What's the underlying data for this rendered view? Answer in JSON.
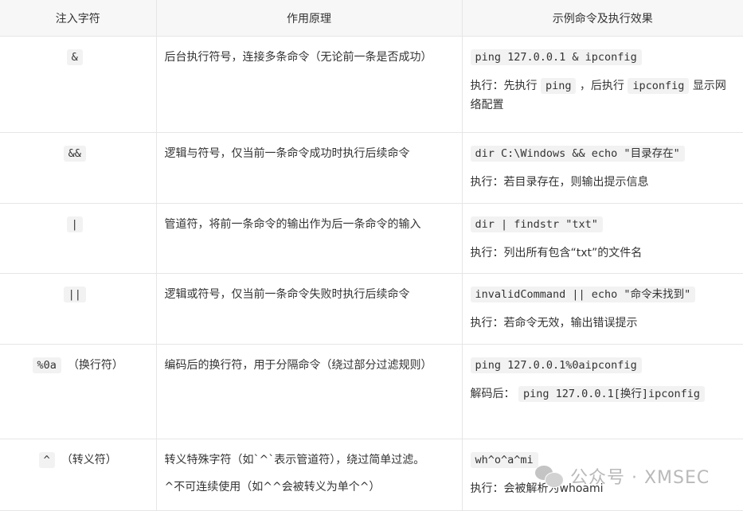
{
  "headers": [
    "注入字符",
    "作用原理",
    "示例命令及执行效果"
  ],
  "rows": [
    {
      "symbol": "&",
      "symbol_note": "",
      "principle": "后台执行符号，连接多条命令（无论前一条是否成功）",
      "principle2": "",
      "example_code": "ping 127.0.0.1 & ipconfig",
      "result_parts": [
        {
          "t": "执行：先执行 ",
          "code": false
        },
        {
          "t": "ping",
          "code": true
        },
        {
          "t": " ，后执行 ",
          "code": false
        },
        {
          "t": "ipconfig",
          "code": true
        },
        {
          "t": " 显示网络配置",
          "code": false
        }
      ]
    },
    {
      "symbol": "&&",
      "symbol_note": "",
      "principle": "逻辑与符号，仅当前一条命令成功时执行后续命令",
      "principle2": "",
      "example_code": "dir C:\\Windows && echo \"目录存在\"",
      "result_parts": [
        {
          "t": "执行：若目录存在，则输出提示信息",
          "code": false
        }
      ]
    },
    {
      "symbol": "|",
      "symbol_note": "",
      "principle": "管道符，将前一条命令的输出作为后一条命令的输入",
      "principle2": "",
      "example_code": "dir | findstr \"txt\"",
      "result_parts": [
        {
          "t": "执行：列出所有包含“txt”的文件名",
          "code": false
        }
      ]
    },
    {
      "symbol": "||",
      "symbol_note": "",
      "principle": "逻辑或符号，仅当前一条命令失败时执行后续命令",
      "principle2": "",
      "example_code": "invalidCommand || echo \"命令未找到\"",
      "result_parts": [
        {
          "t": "执行：若命令无效，输出错误提示",
          "code": false
        }
      ]
    },
    {
      "symbol": "%0a",
      "symbol_note": "（换行符）",
      "principle": "编码后的换行符，用于分隔命令（绕过部分过滤规则）",
      "principle2": "",
      "example_code": "ping 127.0.0.1%0aipconfig",
      "result_parts": [
        {
          "t": "解码后： ",
          "code": false
        },
        {
          "t": "ping 127.0.0.1[换行]ipconfig",
          "code": true
        }
      ]
    },
    {
      "symbol": "^",
      "symbol_note": "（转义符）",
      "principle": "转义特殊字符（如`^`表示管道符），绕过简单过滤。",
      "principle2": "^不可连续使用（如^^会被转义为单个^）",
      "example_code": "wh^o^a^mi",
      "result_parts": [
        {
          "t": "执行：会被解析为whoami",
          "code": false
        }
      ]
    }
  ],
  "watermark": "公众号 · XMSEC"
}
